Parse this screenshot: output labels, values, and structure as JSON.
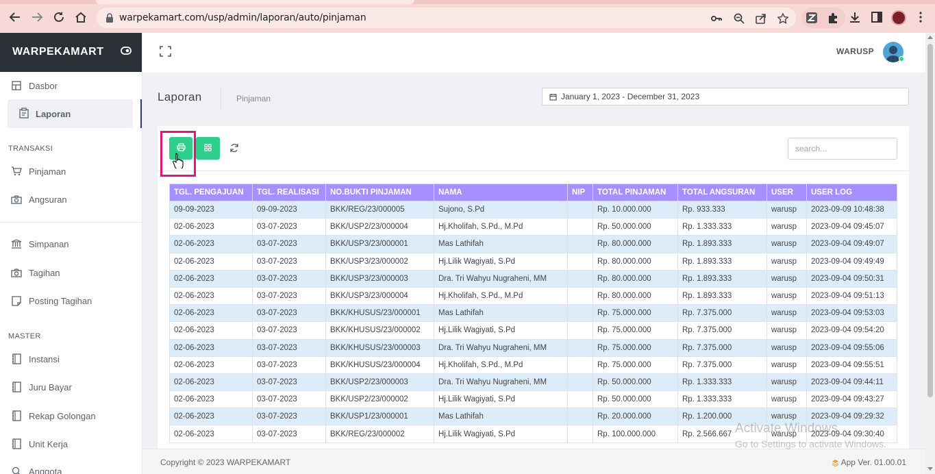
{
  "browser": {
    "url": "warpekamart.com/usp/admin/laporan/auto/pinjaman"
  },
  "sidebar": {
    "brand": "WARPEKAMART",
    "items_top": [
      {
        "label": "Dasbor",
        "icon": "dashboard-icon"
      },
      {
        "label": "Laporan",
        "icon": "clipboard-icon",
        "active": true
      }
    ],
    "section_transaksi": "TRANSAKSI",
    "items_transaksi": [
      {
        "label": "Pinjaman",
        "icon": "cart-icon"
      },
      {
        "label": "Angsuran",
        "icon": "camera-icon"
      }
    ],
    "items_mid": [
      {
        "label": "Simpanan",
        "icon": "bank-icon"
      },
      {
        "label": "Tagihan",
        "icon": "camera-icon"
      },
      {
        "label": "Posting Tagihan",
        "icon": "note-icon"
      }
    ],
    "section_master": "MASTER",
    "items_master": [
      {
        "label": "Instansi",
        "icon": "book-icon"
      },
      {
        "label": "Juru Bayar",
        "icon": "book-icon"
      },
      {
        "label": "Rekap Golongan",
        "icon": "book-icon"
      },
      {
        "label": "Unit Kerja",
        "icon": "book-icon"
      },
      {
        "label": "Anggota",
        "icon": "search-icon"
      }
    ]
  },
  "header": {
    "user": "WARUSP"
  },
  "page": {
    "title": "Laporan",
    "subtitle": "Pinjaman",
    "date_range": "January 1, 2023 - December 31, 2023"
  },
  "toolbar": {
    "search_placeholder": "search..."
  },
  "table": {
    "columns": [
      "TGL. PENGAJUAN",
      "TGL. REALISASI",
      "NO.BUKTI PINJAMAN",
      "NAMA",
      "NIP",
      "TOTAL PINJAMAN",
      "TOTAL ANGSURAN",
      "USER",
      "USER LOG"
    ],
    "rows": [
      [
        "09-09-2023",
        "09-09-2023",
        "BKK/REG/23/000005",
        "Sujono, S.Pd",
        "",
        "Rp. 10.000.000",
        "Rp. 933.333",
        "warusp",
        "2023-09-09 10:48:38"
      ],
      [
        "02-06-2023",
        "03-07-2023",
        "BKK/USP2/23/000004",
        "Hj.Kholifah, S.Pd., M.Pd",
        "",
        "Rp. 50.000.000",
        "Rp. 1.333.333",
        "warusp",
        "2023-09-04 09:45:07"
      ],
      [
        "02-06-2023",
        "03-07-2023",
        "BKK/USP3/23/000001",
        "Mas Lathifah",
        "",
        "Rp. 80.000.000",
        "Rp. 1.893.333",
        "warusp",
        "2023-09-04 09:49:07"
      ],
      [
        "02-06-2023",
        "03-07-2023",
        "BKK/USP3/23/000002",
        "Hj.Lilik Wagiyati, S.Pd",
        "",
        "Rp. 80.000.000",
        "Rp. 1.893.333",
        "warusp",
        "2023-09-04 09:49:49"
      ],
      [
        "02-06-2023",
        "03-07-2023",
        "BKK/USP3/23/000003",
        "Dra. Tri Wahyu Nugraheni, MM",
        "",
        "Rp. 80.000.000",
        "Rp. 1.893.333",
        "warusp",
        "2023-09-04 09:50:31"
      ],
      [
        "02-06-2023",
        "03-07-2023",
        "BKK/USP3/23/000004",
        "Hj.Kholifah, S.Pd., M.Pd",
        "",
        "Rp. 80.000.000",
        "Rp. 1.893.333",
        "warusp",
        "2023-09-04 09:51:13"
      ],
      [
        "02-06-2023",
        "03-07-2023",
        "BKK/KHUSUS/23/000001",
        "Mas Lathifah",
        "",
        "Rp. 75.000.000",
        "Rp. 7.375.000",
        "warusp",
        "2023-09-04 09:53:03"
      ],
      [
        "02-06-2023",
        "03-07-2023",
        "BKK/KHUSUS/23/000002",
        "Hj.Lilik Wagiyati, S.Pd",
        "",
        "Rp. 75.000.000",
        "Rp. 7.375.000",
        "warusp",
        "2023-09-04 09:54:20"
      ],
      [
        "02-06-2023",
        "03-07-2023",
        "BKK/KHUSUS/23/000003",
        "Dra. Tri Wahyu Nugraheni, MM",
        "",
        "Rp. 75.000.000",
        "Rp. 7.375.000",
        "warusp",
        "2023-09-04 09:55:06"
      ],
      [
        "02-06-2023",
        "03-07-2023",
        "BKK/KHUSUS/23/000004",
        "Hj.Kholifah, S.Pd., M.Pd",
        "",
        "Rp. 75.000.000",
        "Rp. 7.375.000",
        "warusp",
        "2023-09-04 09:55:51"
      ],
      [
        "02-06-2023",
        "03-07-2023",
        "BKK/USP2/23/000003",
        "Dra. Tri Wahyu Nugraheni, MM",
        "",
        "Rp. 50.000.000",
        "Rp. 1.333.333",
        "warusp",
        "2023-09-04 09:44:11"
      ],
      [
        "02-06-2023",
        "03-07-2023",
        "BKK/USP2/23/000002",
        "Hj.Lilik Wagiyati, S.Pd",
        "",
        "Rp. 50.000.000",
        "Rp. 1.333.333",
        "warusp",
        "2023-09-04 09:43:27"
      ],
      [
        "02-06-2023",
        "03-07-2023",
        "BKK/USP1/23/000001",
        "Mas Lathifah",
        "",
        "Rp. 20.000.000",
        "Rp. 1.200.000",
        "warusp",
        "2023-09-04 09:29:32"
      ],
      [
        "02-06-2023",
        "03-07-2023",
        "BKK/REG/23/000002",
        "Hj.Lilik Wagiyati, S.Pd",
        "",
        "Rp. 100.000.000",
        "Rp. 2.566.667",
        "warusp",
        "2023-09-04 09:30:40"
      ]
    ]
  },
  "footer": {
    "copyright": "Copyright © 2023 WARPEKAMART",
    "version": "App Ver. 01.00.01"
  },
  "watermark": {
    "line1": "Activate Windows",
    "line2": "Go to Settings to activate Windows."
  },
  "colors": {
    "brand_bar": "#2b3036",
    "table_header": "#a690ff",
    "row_alt": "#dcecf9",
    "action_button": "#2dcf8a",
    "highlight": "#e0187a"
  }
}
